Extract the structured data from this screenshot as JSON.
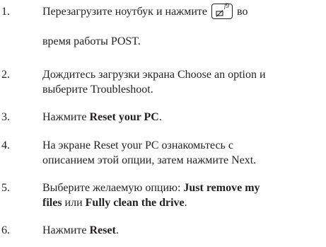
{
  "steps": [
    {
      "number": "1.",
      "line1_before": "Перезагрузите ноутбук и нажмите",
      "key_label": "f9",
      "key_icon": "hard-drive-recovery-icon",
      "line1_after": "во",
      "line2": "время работы POST."
    },
    {
      "number": "2.",
      "line1": "Дождитесь загрузки экрана Choose an option и",
      "line2": "выберите Troubleshoot."
    },
    {
      "number": "3.",
      "prefix": "Нажмите ",
      "bold": "Reset your PC",
      "suffix": "."
    },
    {
      "number": "4.",
      "line1": "На экране Reset your PC ознакомьтесь с",
      "line2": "описанием этой опции, затем нажмите Next."
    },
    {
      "number": "5.",
      "line1_prefix": "Выберите желаемую опцию: ",
      "bold1": "Just remove my",
      "bold1_cont": "files",
      "middle": " или ",
      "bold2": "Fully clean the drive",
      "suffix": "."
    },
    {
      "number": "6.",
      "prefix": "Нажмите ",
      "bold": "Reset",
      "suffix": "."
    }
  ]
}
